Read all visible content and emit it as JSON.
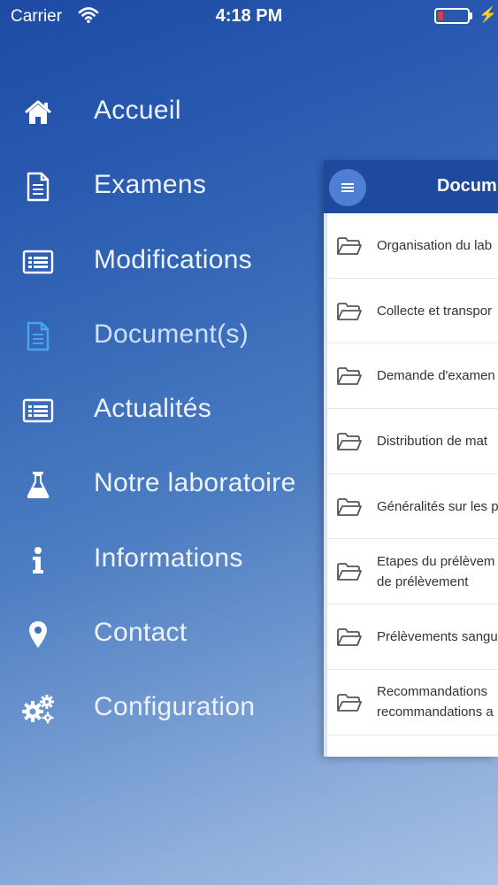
{
  "status_bar": {
    "carrier": "Carrier",
    "time": "4:18 PM"
  },
  "menu": {
    "items": [
      {
        "label": "Accueil",
        "icon": "home-icon"
      },
      {
        "label": "Examens",
        "icon": "document-icon"
      },
      {
        "label": "Modifications",
        "icon": "list-card-icon"
      },
      {
        "label": "Document(s)",
        "icon": "document-icon",
        "active": true
      },
      {
        "label": "Actualités",
        "icon": "list-card-icon"
      },
      {
        "label": "Notre laboratoire",
        "icon": "flask-icon"
      },
      {
        "label": "Informations",
        "icon": "info-icon"
      },
      {
        "label": "Contact",
        "icon": "location-pin-icon"
      },
      {
        "label": "Configuration",
        "icon": "gears-icon"
      }
    ]
  },
  "documents_panel": {
    "title": "Docum",
    "items": [
      {
        "line1": "Organisation du lab",
        "line2": ""
      },
      {
        "line1": "Collecte et transpor",
        "line2": ""
      },
      {
        "line1": "Demande d'examen",
        "line2": ""
      },
      {
        "line1": "Distribution de mat",
        "line2": ""
      },
      {
        "line1": "Généralités sur les p",
        "line2": ""
      },
      {
        "line1": "Etapes du prélèvem",
        "line2": "de prélèvement"
      },
      {
        "line1": "Prélèvements sangu",
        "line2": ""
      },
      {
        "line1": "Recommandations",
        "line2": "recommandations a"
      }
    ]
  },
  "colors": {
    "header_bg": "#1e4a9e",
    "active_icon": "#4aa3f0",
    "battery_low": "#e53935"
  }
}
